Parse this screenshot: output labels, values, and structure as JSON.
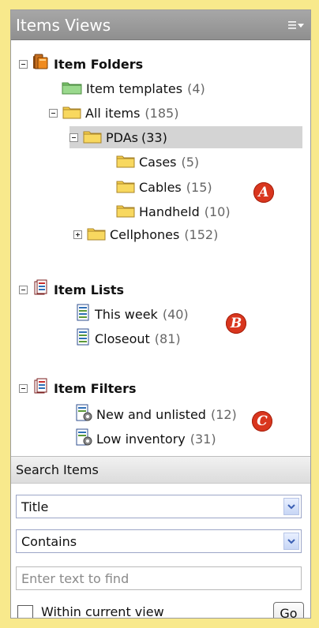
{
  "panel": {
    "title": "Items Views",
    "menu_icon": "list-menu-icon"
  },
  "tree": {
    "folders": {
      "label": "Item Folders",
      "icon": "folder-stack-icon",
      "children": [
        {
          "label": "Item templates",
          "count": "(4)",
          "icon": "green-folder-icon"
        },
        {
          "label": "All items",
          "count": "(185)",
          "icon": "folder-icon"
        },
        {
          "label": "PDAs",
          "count": "(33)",
          "icon": "folder-icon"
        },
        {
          "label": "Cases",
          "count": "(5)",
          "icon": "folder-icon"
        },
        {
          "label": "Cables",
          "count": "(15)",
          "icon": "folder-icon"
        },
        {
          "label": "Handheld",
          "count": "(10)",
          "icon": "folder-icon"
        },
        {
          "label": "Cellphones",
          "count": "(152)",
          "icon": "folder-icon"
        }
      ]
    },
    "lists": {
      "label": "Item Lists",
      "icon": "clipboard-icon",
      "children": [
        {
          "label": "This week",
          "count": "(40)",
          "icon": "list-document-icon"
        },
        {
          "label": "Closeout",
          "count": "(81)",
          "icon": "list-document-icon"
        }
      ]
    },
    "filters": {
      "label": "Item Filters",
      "icon": "clipboard-icon",
      "children": [
        {
          "label": "New and unlisted",
          "count": "(12)",
          "icon": "filter-document-icon"
        },
        {
          "label": "Low inventory",
          "count": "(31)",
          "icon": "filter-document-icon"
        }
      ]
    }
  },
  "callouts": [
    "A",
    "B",
    "C"
  ],
  "search": {
    "title": "Search Items",
    "field_select": "Title",
    "operator_select": "Contains",
    "placeholder": "Enter text to find",
    "checkbox_label": "Within current view",
    "go_label": "Go"
  },
  "colors": {
    "page_background": "#F8E98C",
    "header_background": "#999999",
    "selected_row": "#D4D4D4",
    "badge": "#D9361E",
    "folder": "#F3C73A"
  }
}
